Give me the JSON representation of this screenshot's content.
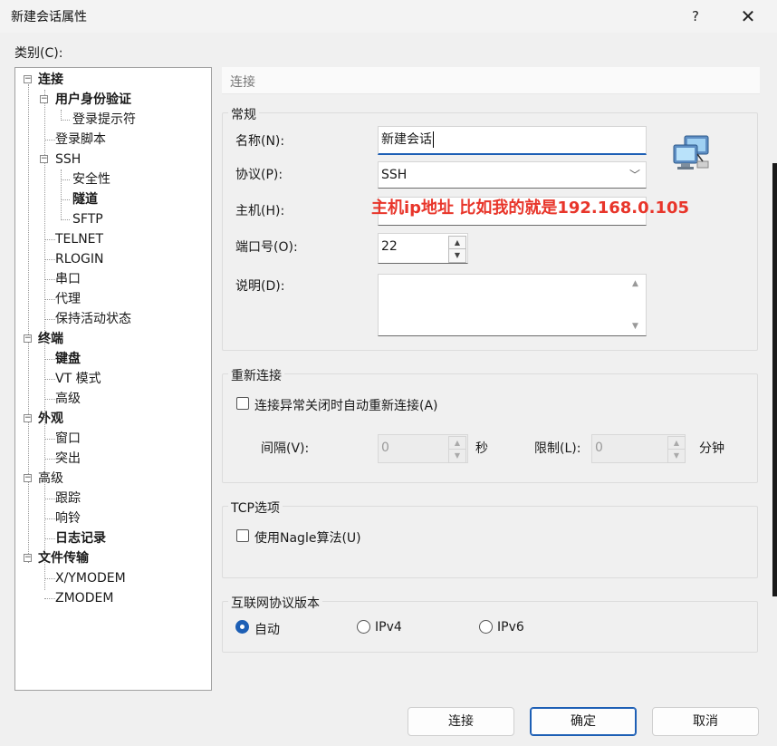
{
  "window": {
    "title": "新建会话属性",
    "help": "?",
    "close": "✕"
  },
  "category_label": "类别(C):",
  "tree": [
    {
      "label": "连接",
      "bold": true
    },
    {
      "label": "用户身份验证",
      "bold": true
    },
    {
      "label": "登录提示符",
      "bold": false
    },
    {
      "label": "登录脚本",
      "bold": false
    },
    {
      "label": "SSH",
      "bold": false
    },
    {
      "label": "安全性",
      "bold": false
    },
    {
      "label": "隧道",
      "bold": true
    },
    {
      "label": "SFTP",
      "bold": false
    },
    {
      "label": "TELNET",
      "bold": false
    },
    {
      "label": "RLOGIN",
      "bold": false
    },
    {
      "label": "串口",
      "bold": false
    },
    {
      "label": "代理",
      "bold": false
    },
    {
      "label": "保持活动状态",
      "bold": false
    },
    {
      "label": "终端",
      "bold": true
    },
    {
      "label": "键盘",
      "bold": true
    },
    {
      "label": "VT 模式",
      "bold": false
    },
    {
      "label": "高级",
      "bold": false
    },
    {
      "label": "外观",
      "bold": true
    },
    {
      "label": "窗口",
      "bold": false
    },
    {
      "label": "突出",
      "bold": false
    },
    {
      "label": "高级",
      "bold": false
    },
    {
      "label": "跟踪",
      "bold": false
    },
    {
      "label": "响铃",
      "bold": false
    },
    {
      "label": "日志记录",
      "bold": true
    },
    {
      "label": "文件传输",
      "bold": true
    },
    {
      "label": "X/YMODEM",
      "bold": false
    },
    {
      "label": "ZMODEM",
      "bold": false
    }
  ],
  "panel": {
    "header": "连接",
    "general": {
      "title": "常规",
      "name_label": "名称(N):",
      "name_value": "新建会话",
      "protocol_label": "协议(P):",
      "protocol_value": "SSH",
      "host_label": "主机(H):",
      "host_value": "",
      "port_label": "端口号(O):",
      "port_value": "22",
      "desc_label": "说明(D):",
      "desc_value": ""
    },
    "annotation": "主机ip地址 比如我的就是192.168.0.105",
    "reconnect": {
      "title": "重新连接",
      "checkbox_label": "连接异常关闭时自动重新连接(A)",
      "interval_label": "间隔(V):",
      "interval_value": "0",
      "interval_unit": "秒",
      "limit_label": "限制(L):",
      "limit_value": "0",
      "limit_unit": "分钟"
    },
    "tcp": {
      "title": "TCP选项",
      "nagle_label": "使用Nagle算法(U)"
    },
    "ipver": {
      "title": "互联网协议版本",
      "options": [
        "自动",
        "IPv4",
        "IPv6"
      ],
      "selected": "自动"
    }
  },
  "buttons": {
    "connect": "连接",
    "ok": "确定",
    "cancel": "取消"
  },
  "colors": {
    "accent": "#1d5fb5",
    "annotation": "#e8352a"
  }
}
